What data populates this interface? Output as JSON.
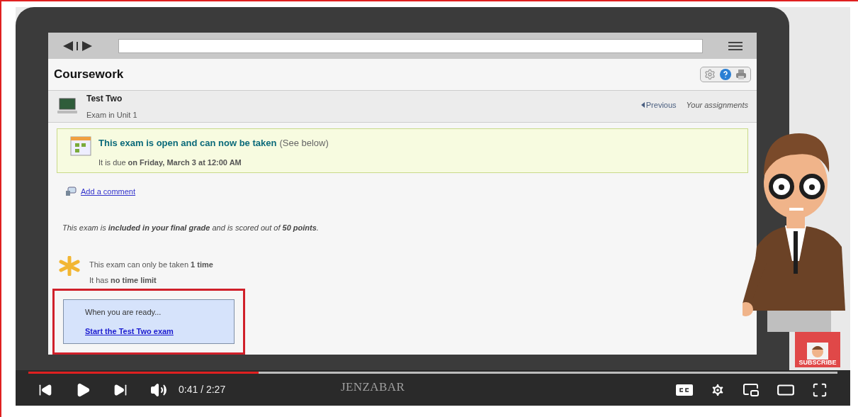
{
  "page": {
    "title": "Coursework",
    "item": {
      "title": "Test Two",
      "subtitle": "Exam in Unit 1"
    },
    "nav": {
      "previous": "Previous",
      "assignments": "Your assignments"
    },
    "notice": {
      "headline": "This exam is open and can now be taken",
      "note": "(See below)",
      "due": "It is due **on Friday, March 3 at 12:00 AM**"
    },
    "comment_link": "Add a comment",
    "grading": "This exam is **included in your final grade** and is scored out of **50 points**.",
    "limits": [
      "This exam can only be taken **1 time**",
      "It has **no time limit**"
    ],
    "start": {
      "prompt": "When you are ready...",
      "link": "Start the Test Two exam",
      "highlighted": true
    }
  },
  "subscribe_badge": "SUBSCRIBE",
  "player": {
    "paused": true,
    "progress": {
      "level": 0.285
    },
    "time": "0:41 / 2:27",
    "logo": "JENZABAR"
  }
}
